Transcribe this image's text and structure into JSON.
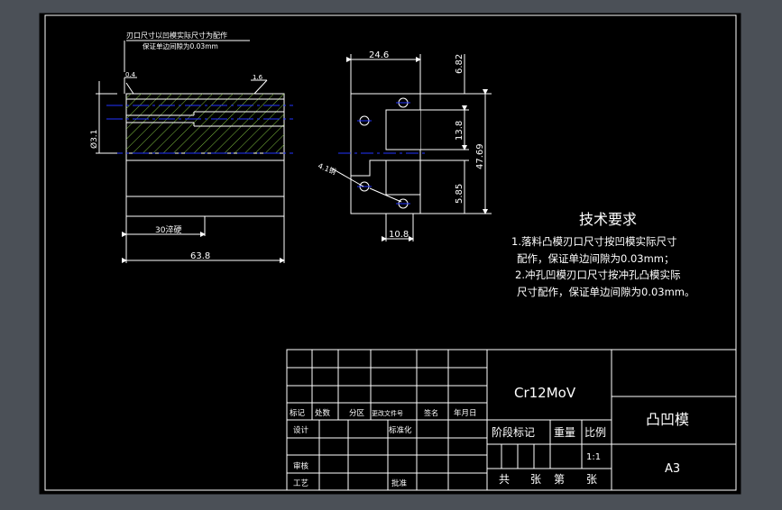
{
  "top_note": {
    "line1": "刃口尺寸以凹模实际尺寸为配作",
    "line2": "保证单边间隙为0.03mm"
  },
  "side_view": {
    "dim_left_chamfer": "0.4",
    "dim_right_chamfer": "1.6",
    "dim_diameter": "Ø3.1",
    "dim_hardened_length": "30淬硬",
    "dim_total_length": "63.8"
  },
  "front_view": {
    "dim_top_width": "24.6",
    "dim_top_height": "6.82",
    "dim_slot_height": "13.8",
    "dim_total_height": "47.69",
    "dim_lower_height": "5.85",
    "dim_bottom_width": "10.8",
    "dim_holes": "4.1销"
  },
  "tech_requirements": {
    "title": "技术要求",
    "item1_line1": "1.落料凸模刃口尺寸按凹模实际尺寸",
    "item1_line2": "配作，保证单边间隙为0.03mm；",
    "item2_line1": "2.冲孔凹模刃口尺寸按冲孔凸模实际",
    "item2_line2": "尺寸配作，保证单边间隙为0.03mm。"
  },
  "title_block": {
    "material": "Cr12MoV",
    "part_name": "凸凹模",
    "sheet_size": "A3",
    "scale_value": "1:1",
    "headers": {
      "mark": "标记",
      "count": "处数",
      "zone": "分区",
      "change_doc": "更改文件号",
      "signature": "签名",
      "date": "年月日",
      "design": "设计",
      "standardize": "标准化",
      "review": "审核",
      "process": "工艺",
      "approve": "批准",
      "stage_mark": "阶段标记",
      "weight": "重量",
      "scale": "比例",
      "total": "共",
      "sheets": "张",
      "sheet_no": "第",
      "sheet_suffix": "张"
    }
  },
  "colors": {
    "background": "#4b5057",
    "sheet": "#000000",
    "lines": "#ffffff",
    "hatch": "#7fbf3f",
    "center": "#2233ff",
    "dimension": "#ffffff"
  }
}
